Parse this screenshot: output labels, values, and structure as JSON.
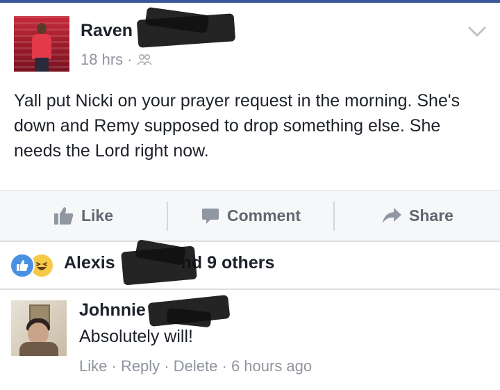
{
  "post": {
    "author": "Raven",
    "time": "18 hrs",
    "time_separator": "·",
    "privacy_icon": "friends-icon",
    "text": "Yall put Nicki on your prayer request in the morning. She's down and Remy supposed to drop something else. She needs the Lord right now."
  },
  "actions": {
    "like": "Like",
    "comment": "Comment",
    "share": "Share"
  },
  "reactions": {
    "icons": [
      "like-reaction-icon",
      "haha-reaction-icon"
    ],
    "summary_start": "Alexis",
    "summary_end": "nd 9 others"
  },
  "comment": {
    "author": "Johnnie",
    "text": "Absolutely will!",
    "like": "Like",
    "reply": "Reply",
    "delete": "Delete",
    "time": "6 hours ago",
    "separator": "·"
  },
  "colors": {
    "accent": "#3b5998",
    "text": "#1d2129",
    "muted": "#90949c",
    "action_bar": "#f6f7f9",
    "like_reaction": "#4a90e2",
    "haha_reaction": "#f7c948"
  }
}
